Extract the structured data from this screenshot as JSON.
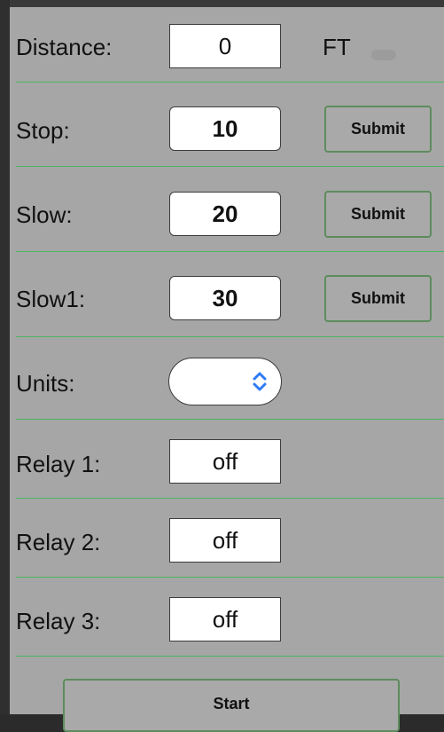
{
  "form": {
    "distance": {
      "label": "Distance:",
      "value": "0",
      "unit": "FT"
    },
    "stop": {
      "label": "Stop:",
      "value": "10",
      "button": "Submit"
    },
    "slow": {
      "label": "Slow:",
      "value": "20",
      "button": "Submit"
    },
    "slow1": {
      "label": "Slow1:",
      "value": "30",
      "button": "Submit"
    },
    "units": {
      "label": "Units:",
      "selected": ""
    },
    "relay1": {
      "label": "Relay 1:",
      "value": "off"
    },
    "relay2": {
      "label": "Relay 2:",
      "value": "off"
    },
    "relay3": {
      "label": "Relay 3:",
      "value": "off"
    },
    "start_button": "Start"
  },
  "colors": {
    "panel": "#a6a6a6",
    "divider": "#4bb55f",
    "button_border": "#5d8c5d",
    "accent_icon": "#2f7bf6"
  },
  "icons": {
    "units_select": "chevron-up-down-icon"
  }
}
